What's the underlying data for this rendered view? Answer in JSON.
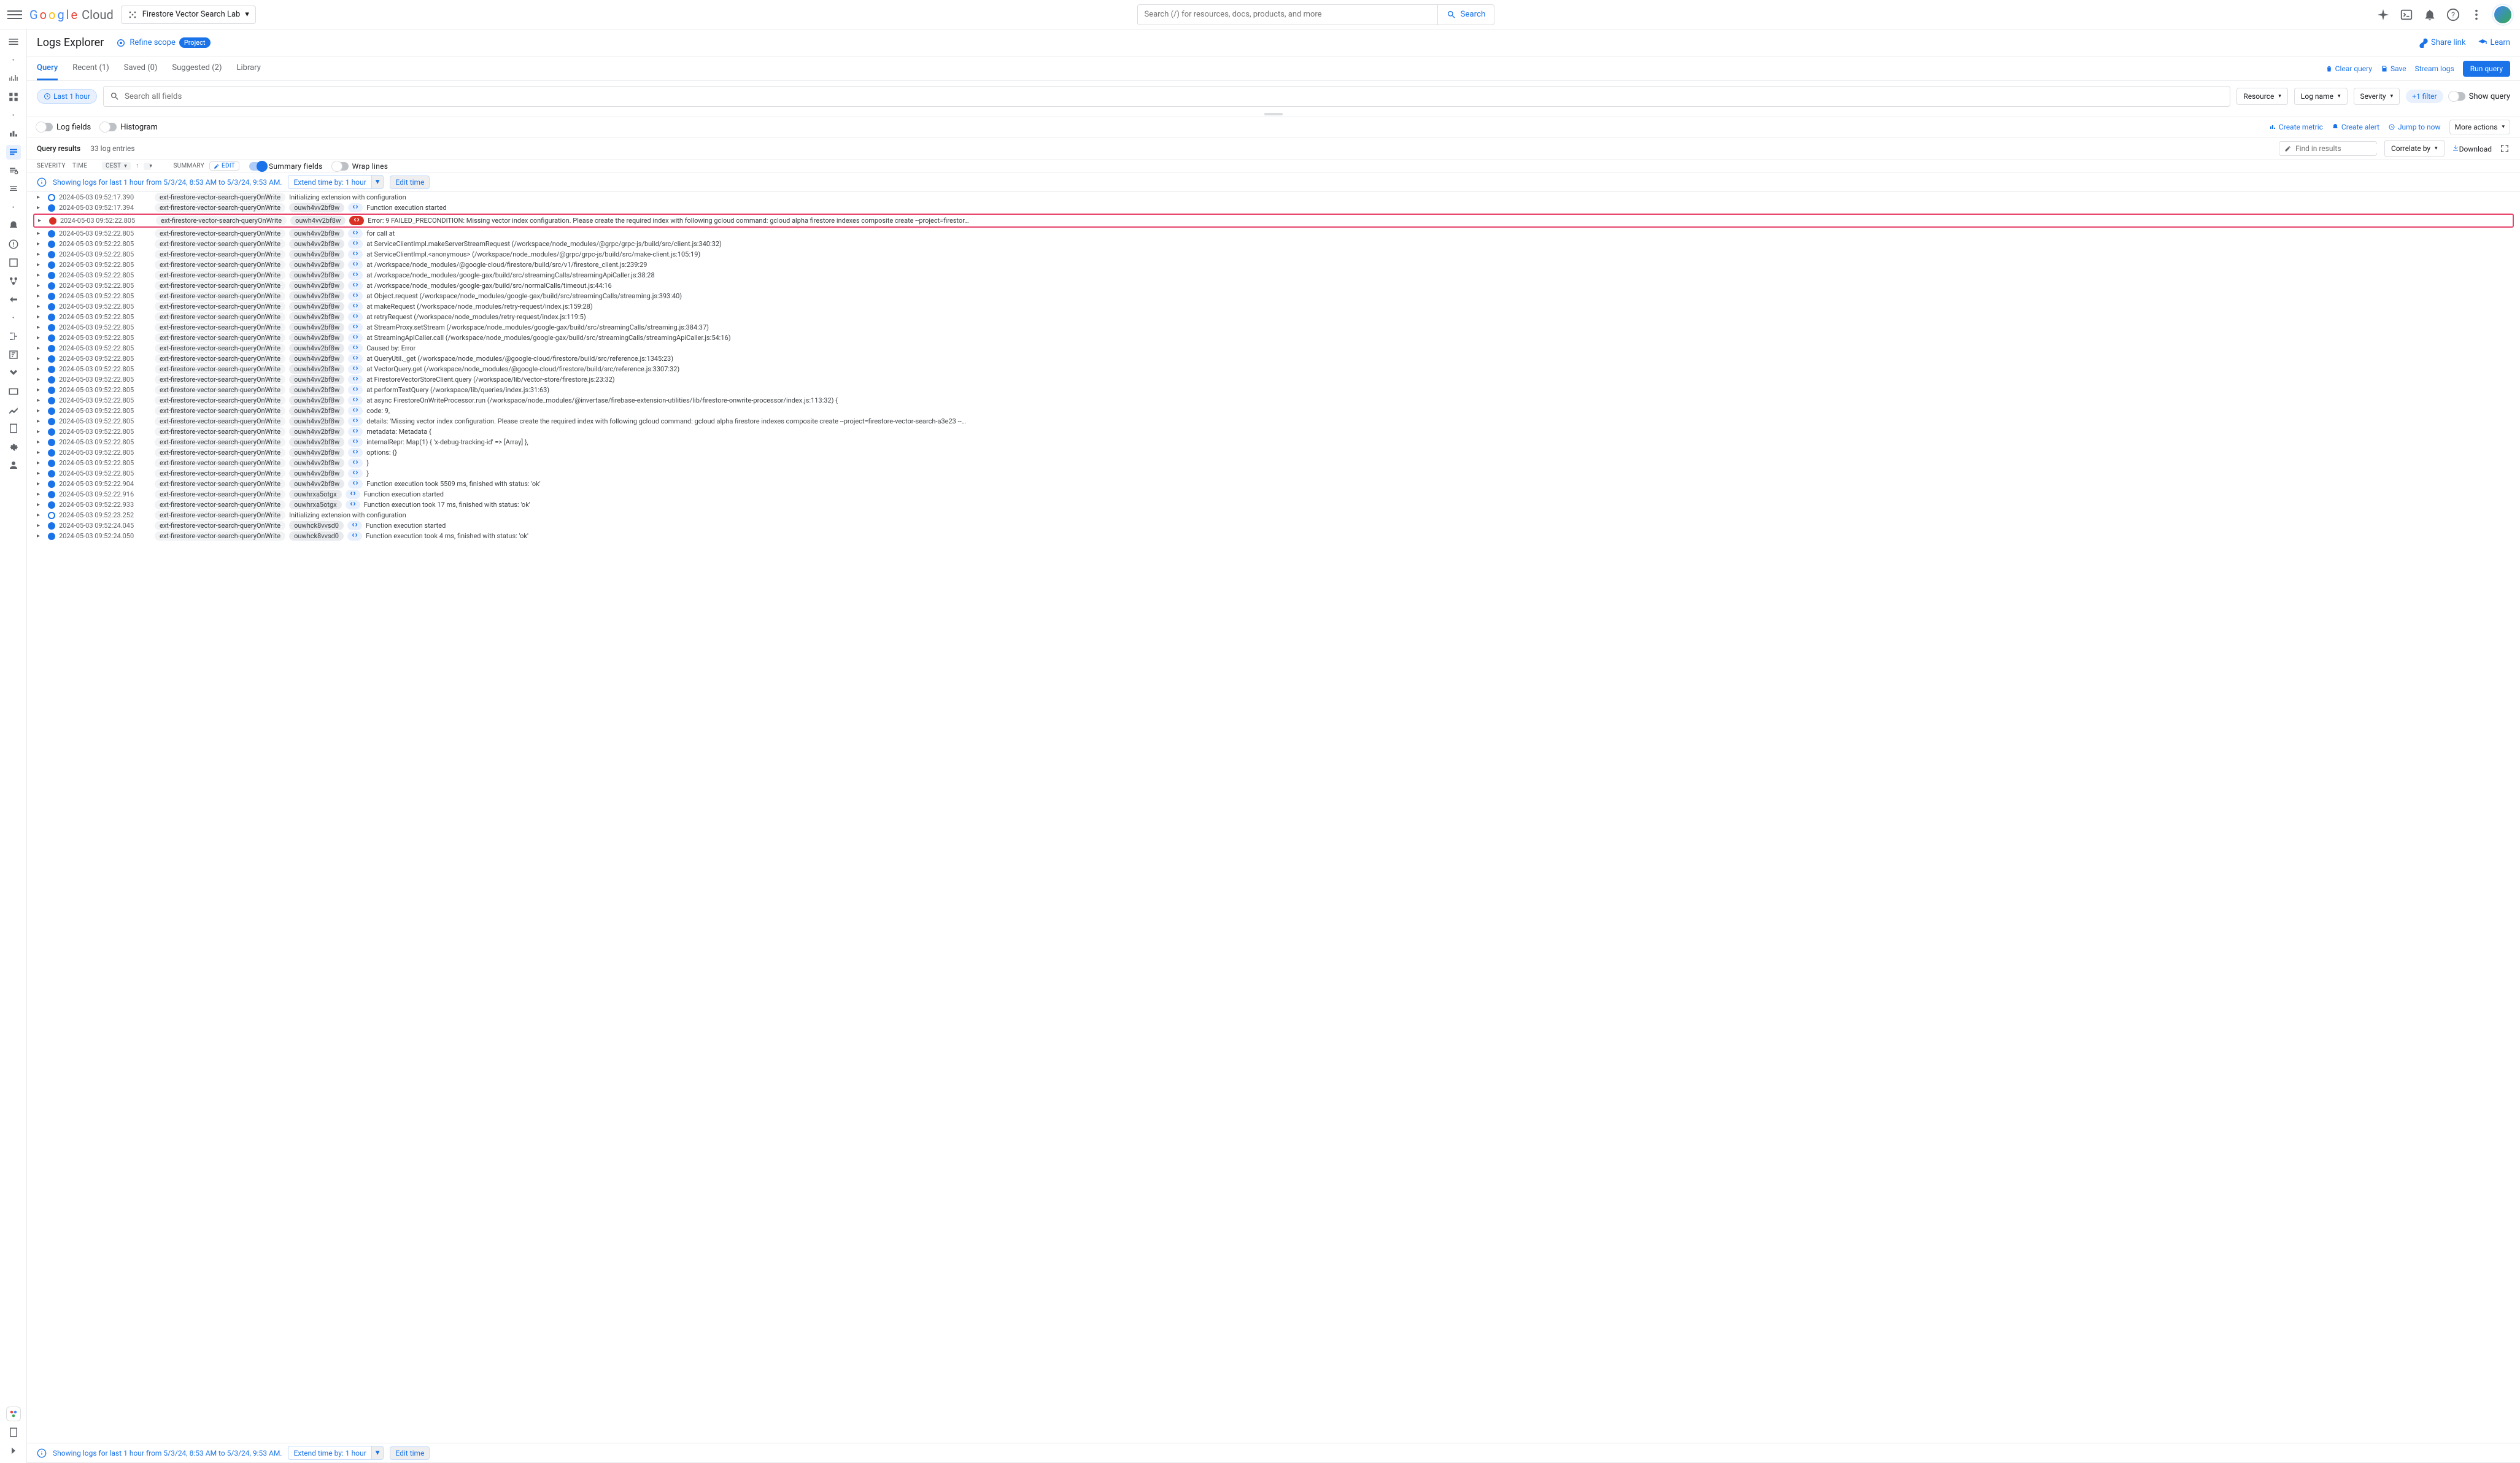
{
  "header": {
    "project_name": "Firestore Vector Search Lab",
    "search_placeholder": "Search (/) for resources, docs, products, and more",
    "search_button": "Search"
  },
  "subheader": {
    "title": "Logs Explorer",
    "refine": "Refine scope",
    "project_badge": "Project",
    "share": "Share link",
    "learn": "Learn"
  },
  "tabs": {
    "items": [
      "Query",
      "Recent (1)",
      "Saved (0)",
      "Suggested (2)",
      "Library"
    ],
    "clear": "Clear query",
    "save": "Save",
    "stream": "Stream logs",
    "run": "Run query"
  },
  "query_bar": {
    "time_chip": "Last 1 hour",
    "fields_placeholder": "Search all fields",
    "resource": "Resource",
    "logname": "Log name",
    "severity": "Severity",
    "more_filter": "+1 filter",
    "show_query": "Show query"
  },
  "toggles_row": {
    "log_fields": "Log fields",
    "histogram": "Histogram",
    "create_metric": "Create metric",
    "create_alert": "Create alert",
    "jump": "Jump to now",
    "more": "More actions"
  },
  "results_header": {
    "title": "Query results",
    "count": "33 log entries",
    "find_placeholder": "Find in results",
    "correlate": "Correlate by",
    "download": "Download"
  },
  "cols": {
    "severity": "SEVERITY",
    "time": "TIME",
    "cest": "CEST",
    "summary": "SUMMARY",
    "edit": "Edit",
    "summary_fields": "Summary fields",
    "wrap_lines": "Wrap lines"
  },
  "info_bar": {
    "text": "Showing logs for last 1 hour from 5/3/24, 8:53 AM to 5/3/24, 9:53 AM.",
    "extend": "Extend time by: 1 hour",
    "edit_time": "Edit time"
  },
  "func_name": "ext-firestore-vector-search-queryOnWrite",
  "run_a": "ouwh4vv2bf8w",
  "run_b": "ouwhrxa5otgx",
  "run_c": "ouwhck8vvsd0",
  "logs": [
    {
      "ts": "2024-05-03 09:52:17.390",
      "sev": "INFO",
      "fn": true,
      "msg": "Initializing extension with configuration"
    },
    {
      "ts": "2024-05-03 09:52:17.394",
      "sev": "DEBUG",
      "fn": true,
      "run": "a",
      "ic": true,
      "msg": "Function execution started",
      "strike": true
    },
    {
      "ts": "2024-05-03 09:52:22.805",
      "sev": "ERROR",
      "fn": true,
      "run": "a",
      "ic": true,
      "icerr": true,
      "hl": true,
      "msg": "Error: 9 FAILED_PRECONDITION: Missing vector index configuration. Please create the required index with following gcloud command: gcloud alpha firestore indexes composite create --project=firestor…"
    },
    {
      "ts": "2024-05-03 09:52:22.805",
      "sev": "DEBUG",
      "fn": true,
      "run": "a",
      "ic": true,
      "msg": "for call at",
      "strike": true
    },
    {
      "ts": "2024-05-03 09:52:22.805",
      "sev": "DEBUG",
      "fn": true,
      "run": "a",
      "ic": true,
      "msg": "    at ServiceClientImpl.makeServerStreamRequest (/workspace/node_modules/@grpc/grpc-js/build/src/client.js:340:32)"
    },
    {
      "ts": "2024-05-03 09:52:22.805",
      "sev": "DEBUG",
      "fn": true,
      "run": "a",
      "ic": true,
      "msg": "    at ServiceClientImpl.<anonymous> (/workspace/node_modules/@grpc/grpc-js/build/src/make-client.js:105:19)"
    },
    {
      "ts": "2024-05-03 09:52:22.805",
      "sev": "DEBUG",
      "fn": true,
      "run": "a",
      "ic": true,
      "msg": "    at /workspace/node_modules/@google-cloud/firestore/build/src/v1/firestore_client.js:239:29"
    },
    {
      "ts": "2024-05-03 09:52:22.805",
      "sev": "DEBUG",
      "fn": true,
      "run": "a",
      "ic": true,
      "msg": "    at /workspace/node_modules/google-gax/build/src/streamingCalls/streamingApiCaller.js:38:28"
    },
    {
      "ts": "2024-05-03 09:52:22.805",
      "sev": "DEBUG",
      "fn": true,
      "run": "a",
      "ic": true,
      "msg": "    at /workspace/node_modules/google-gax/build/src/normalCalls/timeout.js:44:16"
    },
    {
      "ts": "2024-05-03 09:52:22.805",
      "sev": "DEBUG",
      "fn": true,
      "run": "a",
      "ic": true,
      "msg": "    at Object.request (/workspace/node_modules/google-gax/build/src/streamingCalls/streaming.js:393:40)"
    },
    {
      "ts": "2024-05-03 09:52:22.805",
      "sev": "DEBUG",
      "fn": true,
      "run": "a",
      "ic": true,
      "msg": "    at makeRequest (/workspace/node_modules/retry-request/index.js:159:28)"
    },
    {
      "ts": "2024-05-03 09:52:22.805",
      "sev": "DEBUG",
      "fn": true,
      "run": "a",
      "ic": true,
      "msg": "    at retryRequest (/workspace/node_modules/retry-request/index.js:119:5)"
    },
    {
      "ts": "2024-05-03 09:52:22.805",
      "sev": "DEBUG",
      "fn": true,
      "run": "a",
      "ic": true,
      "msg": "    at StreamProxy.setStream (/workspace/node_modules/google-gax/build/src/streamingCalls/streaming.js:384:37)"
    },
    {
      "ts": "2024-05-03 09:52:22.805",
      "sev": "DEBUG",
      "fn": true,
      "run": "a",
      "ic": true,
      "msg": "    at StreamingApiCaller.call (/workspace/node_modules/google-gax/build/src/streamingCalls/streamingApiCaller.js:54:16)"
    },
    {
      "ts": "2024-05-03 09:52:22.805",
      "sev": "DEBUG",
      "fn": true,
      "run": "a",
      "ic": true,
      "msg": "Caused by: Error"
    },
    {
      "ts": "2024-05-03 09:52:22.805",
      "sev": "DEBUG",
      "fn": true,
      "run": "a",
      "ic": true,
      "msg": "    at QueryUtil._get (/workspace/node_modules/@google-cloud/firestore/build/src/reference.js:1345:23)"
    },
    {
      "ts": "2024-05-03 09:52:22.805",
      "sev": "DEBUG",
      "fn": true,
      "run": "a",
      "ic": true,
      "msg": "    at VectorQuery.get (/workspace/node_modules/@google-cloud/firestore/build/src/reference.js:3307:32)"
    },
    {
      "ts": "2024-05-03 09:52:22.805",
      "sev": "DEBUG",
      "fn": true,
      "run": "a",
      "ic": true,
      "msg": "    at FirestoreVectorStoreClient.query (/workspace/lib/vector-store/firestore.js:23:32)"
    },
    {
      "ts": "2024-05-03 09:52:22.805",
      "sev": "DEBUG",
      "fn": true,
      "run": "a",
      "ic": true,
      "msg": "    at performTextQuery (/workspace/lib/queries/index.js:31:63)"
    },
    {
      "ts": "2024-05-03 09:52:22.805",
      "sev": "DEBUG",
      "fn": true,
      "run": "a",
      "ic": true,
      "msg": "    at async FirestoreOnWriteProcessor.run (/workspace/node_modules/@invertase/firebase-extension-utilities/lib/firestore-onwrite-processor/index.js:113:32) {"
    },
    {
      "ts": "2024-05-03 09:52:22.805",
      "sev": "DEBUG",
      "fn": true,
      "run": "a",
      "ic": true,
      "msg": "  code: 9,"
    },
    {
      "ts": "2024-05-03 09:52:22.805",
      "sev": "DEBUG",
      "fn": true,
      "run": "a",
      "ic": true,
      "msg": "  details: 'Missing vector index configuration. Please create the required index with following gcloud command: gcloud alpha firestore indexes composite create --project=firestore-vector-search-a3e23 --…"
    },
    {
      "ts": "2024-05-03 09:52:22.805",
      "sev": "DEBUG",
      "fn": true,
      "run": "a",
      "ic": true,
      "msg": "  metadata: Metadata {"
    },
    {
      "ts": "2024-05-03 09:52:22.805",
      "sev": "DEBUG",
      "fn": true,
      "run": "a",
      "ic": true,
      "msg": "    internalRepr: Map(1) { 'x-debug-tracking-id' => [Array] },"
    },
    {
      "ts": "2024-05-03 09:52:22.805",
      "sev": "DEBUG",
      "fn": true,
      "run": "a",
      "ic": true,
      "msg": "    options: {}"
    },
    {
      "ts": "2024-05-03 09:52:22.805",
      "sev": "DEBUG",
      "fn": true,
      "run": "a",
      "ic": true,
      "msg": "  }"
    },
    {
      "ts": "2024-05-03 09:52:22.805",
      "sev": "DEBUG",
      "fn": true,
      "run": "a",
      "ic": true,
      "msg": "}"
    },
    {
      "ts": "2024-05-03 09:52:22.904",
      "sev": "DEBUG",
      "fn": true,
      "run": "a",
      "ic": true,
      "msg": "Function execution took 5509 ms, finished with status: 'ok'"
    },
    {
      "ts": "2024-05-03 09:52:22.916",
      "sev": "DEBUG",
      "fn": true,
      "run": "b",
      "ic": true,
      "msg": "Function execution started"
    },
    {
      "ts": "2024-05-03 09:52:22.933",
      "sev": "DEBUG",
      "fn": true,
      "run": "b",
      "ic": true,
      "msg": "Function execution took 17 ms, finished with status: 'ok'"
    },
    {
      "ts": "2024-05-03 09:52:23.252",
      "sev": "INFO",
      "fn": true,
      "msg": "Initializing extension with configuration"
    },
    {
      "ts": "2024-05-03 09:52:24.045",
      "sev": "DEBUG",
      "fn": true,
      "run": "c",
      "ic": true,
      "msg": "Function execution started"
    },
    {
      "ts": "2024-05-03 09:52:24.050",
      "sev": "DEBUG",
      "fn": true,
      "run": "c",
      "ic": true,
      "msg": "Function execution took 4 ms, finished with status: 'ok'"
    }
  ]
}
